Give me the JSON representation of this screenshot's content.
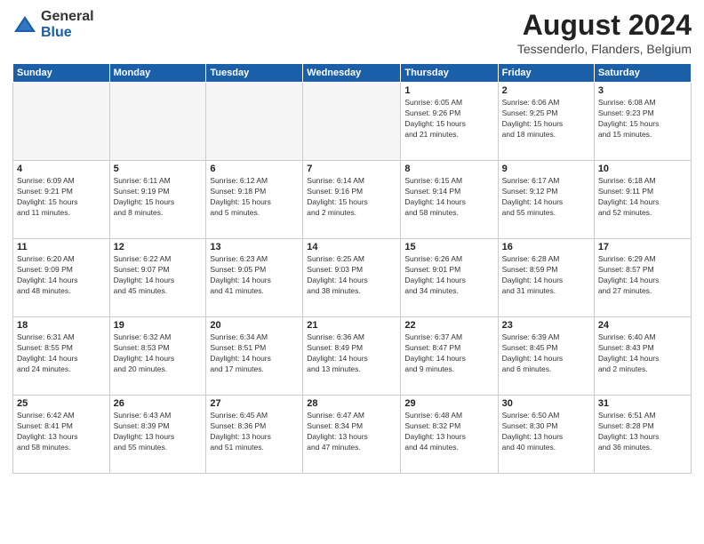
{
  "logo": {
    "general": "General",
    "blue": "Blue"
  },
  "title": "August 2024",
  "location": "Tessenderlo, Flanders, Belgium",
  "days_of_week": [
    "Sunday",
    "Monday",
    "Tuesday",
    "Wednesday",
    "Thursday",
    "Friday",
    "Saturday"
  ],
  "weeks": [
    [
      {
        "day": "",
        "info": "",
        "empty": true
      },
      {
        "day": "",
        "info": "",
        "empty": true
      },
      {
        "day": "",
        "info": "",
        "empty": true
      },
      {
        "day": "",
        "info": "",
        "empty": true
      },
      {
        "day": "1",
        "info": "Sunrise: 6:05 AM\nSunset: 9:26 PM\nDaylight: 15 hours\nand 21 minutes.",
        "empty": false
      },
      {
        "day": "2",
        "info": "Sunrise: 6:06 AM\nSunset: 9:25 PM\nDaylight: 15 hours\nand 18 minutes.",
        "empty": false
      },
      {
        "day": "3",
        "info": "Sunrise: 6:08 AM\nSunset: 9:23 PM\nDaylight: 15 hours\nand 15 minutes.",
        "empty": false
      }
    ],
    [
      {
        "day": "4",
        "info": "Sunrise: 6:09 AM\nSunset: 9:21 PM\nDaylight: 15 hours\nand 11 minutes.",
        "empty": false
      },
      {
        "day": "5",
        "info": "Sunrise: 6:11 AM\nSunset: 9:19 PM\nDaylight: 15 hours\nand 8 minutes.",
        "empty": false
      },
      {
        "day": "6",
        "info": "Sunrise: 6:12 AM\nSunset: 9:18 PM\nDaylight: 15 hours\nand 5 minutes.",
        "empty": false
      },
      {
        "day": "7",
        "info": "Sunrise: 6:14 AM\nSunset: 9:16 PM\nDaylight: 15 hours\nand 2 minutes.",
        "empty": false
      },
      {
        "day": "8",
        "info": "Sunrise: 6:15 AM\nSunset: 9:14 PM\nDaylight: 14 hours\nand 58 minutes.",
        "empty": false
      },
      {
        "day": "9",
        "info": "Sunrise: 6:17 AM\nSunset: 9:12 PM\nDaylight: 14 hours\nand 55 minutes.",
        "empty": false
      },
      {
        "day": "10",
        "info": "Sunrise: 6:18 AM\nSunset: 9:11 PM\nDaylight: 14 hours\nand 52 minutes.",
        "empty": false
      }
    ],
    [
      {
        "day": "11",
        "info": "Sunrise: 6:20 AM\nSunset: 9:09 PM\nDaylight: 14 hours\nand 48 minutes.",
        "empty": false
      },
      {
        "day": "12",
        "info": "Sunrise: 6:22 AM\nSunset: 9:07 PM\nDaylight: 14 hours\nand 45 minutes.",
        "empty": false
      },
      {
        "day": "13",
        "info": "Sunrise: 6:23 AM\nSunset: 9:05 PM\nDaylight: 14 hours\nand 41 minutes.",
        "empty": false
      },
      {
        "day": "14",
        "info": "Sunrise: 6:25 AM\nSunset: 9:03 PM\nDaylight: 14 hours\nand 38 minutes.",
        "empty": false
      },
      {
        "day": "15",
        "info": "Sunrise: 6:26 AM\nSunset: 9:01 PM\nDaylight: 14 hours\nand 34 minutes.",
        "empty": false
      },
      {
        "day": "16",
        "info": "Sunrise: 6:28 AM\nSunset: 8:59 PM\nDaylight: 14 hours\nand 31 minutes.",
        "empty": false
      },
      {
        "day": "17",
        "info": "Sunrise: 6:29 AM\nSunset: 8:57 PM\nDaylight: 14 hours\nand 27 minutes.",
        "empty": false
      }
    ],
    [
      {
        "day": "18",
        "info": "Sunrise: 6:31 AM\nSunset: 8:55 PM\nDaylight: 14 hours\nand 24 minutes.",
        "empty": false
      },
      {
        "day": "19",
        "info": "Sunrise: 6:32 AM\nSunset: 8:53 PM\nDaylight: 14 hours\nand 20 minutes.",
        "empty": false
      },
      {
        "day": "20",
        "info": "Sunrise: 6:34 AM\nSunset: 8:51 PM\nDaylight: 14 hours\nand 17 minutes.",
        "empty": false
      },
      {
        "day": "21",
        "info": "Sunrise: 6:36 AM\nSunset: 8:49 PM\nDaylight: 14 hours\nand 13 minutes.",
        "empty": false
      },
      {
        "day": "22",
        "info": "Sunrise: 6:37 AM\nSunset: 8:47 PM\nDaylight: 14 hours\nand 9 minutes.",
        "empty": false
      },
      {
        "day": "23",
        "info": "Sunrise: 6:39 AM\nSunset: 8:45 PM\nDaylight: 14 hours\nand 6 minutes.",
        "empty": false
      },
      {
        "day": "24",
        "info": "Sunrise: 6:40 AM\nSunset: 8:43 PM\nDaylight: 14 hours\nand 2 minutes.",
        "empty": false
      }
    ],
    [
      {
        "day": "25",
        "info": "Sunrise: 6:42 AM\nSunset: 8:41 PM\nDaylight: 13 hours\nand 58 minutes.",
        "empty": false
      },
      {
        "day": "26",
        "info": "Sunrise: 6:43 AM\nSunset: 8:39 PM\nDaylight: 13 hours\nand 55 minutes.",
        "empty": false
      },
      {
        "day": "27",
        "info": "Sunrise: 6:45 AM\nSunset: 8:36 PM\nDaylight: 13 hours\nand 51 minutes.",
        "empty": false
      },
      {
        "day": "28",
        "info": "Sunrise: 6:47 AM\nSunset: 8:34 PM\nDaylight: 13 hours\nand 47 minutes.",
        "empty": false
      },
      {
        "day": "29",
        "info": "Sunrise: 6:48 AM\nSunset: 8:32 PM\nDaylight: 13 hours\nand 44 minutes.",
        "empty": false
      },
      {
        "day": "30",
        "info": "Sunrise: 6:50 AM\nSunset: 8:30 PM\nDaylight: 13 hours\nand 40 minutes.",
        "empty": false
      },
      {
        "day": "31",
        "info": "Sunrise: 6:51 AM\nSunset: 8:28 PM\nDaylight: 13 hours\nand 36 minutes.",
        "empty": false
      }
    ]
  ]
}
